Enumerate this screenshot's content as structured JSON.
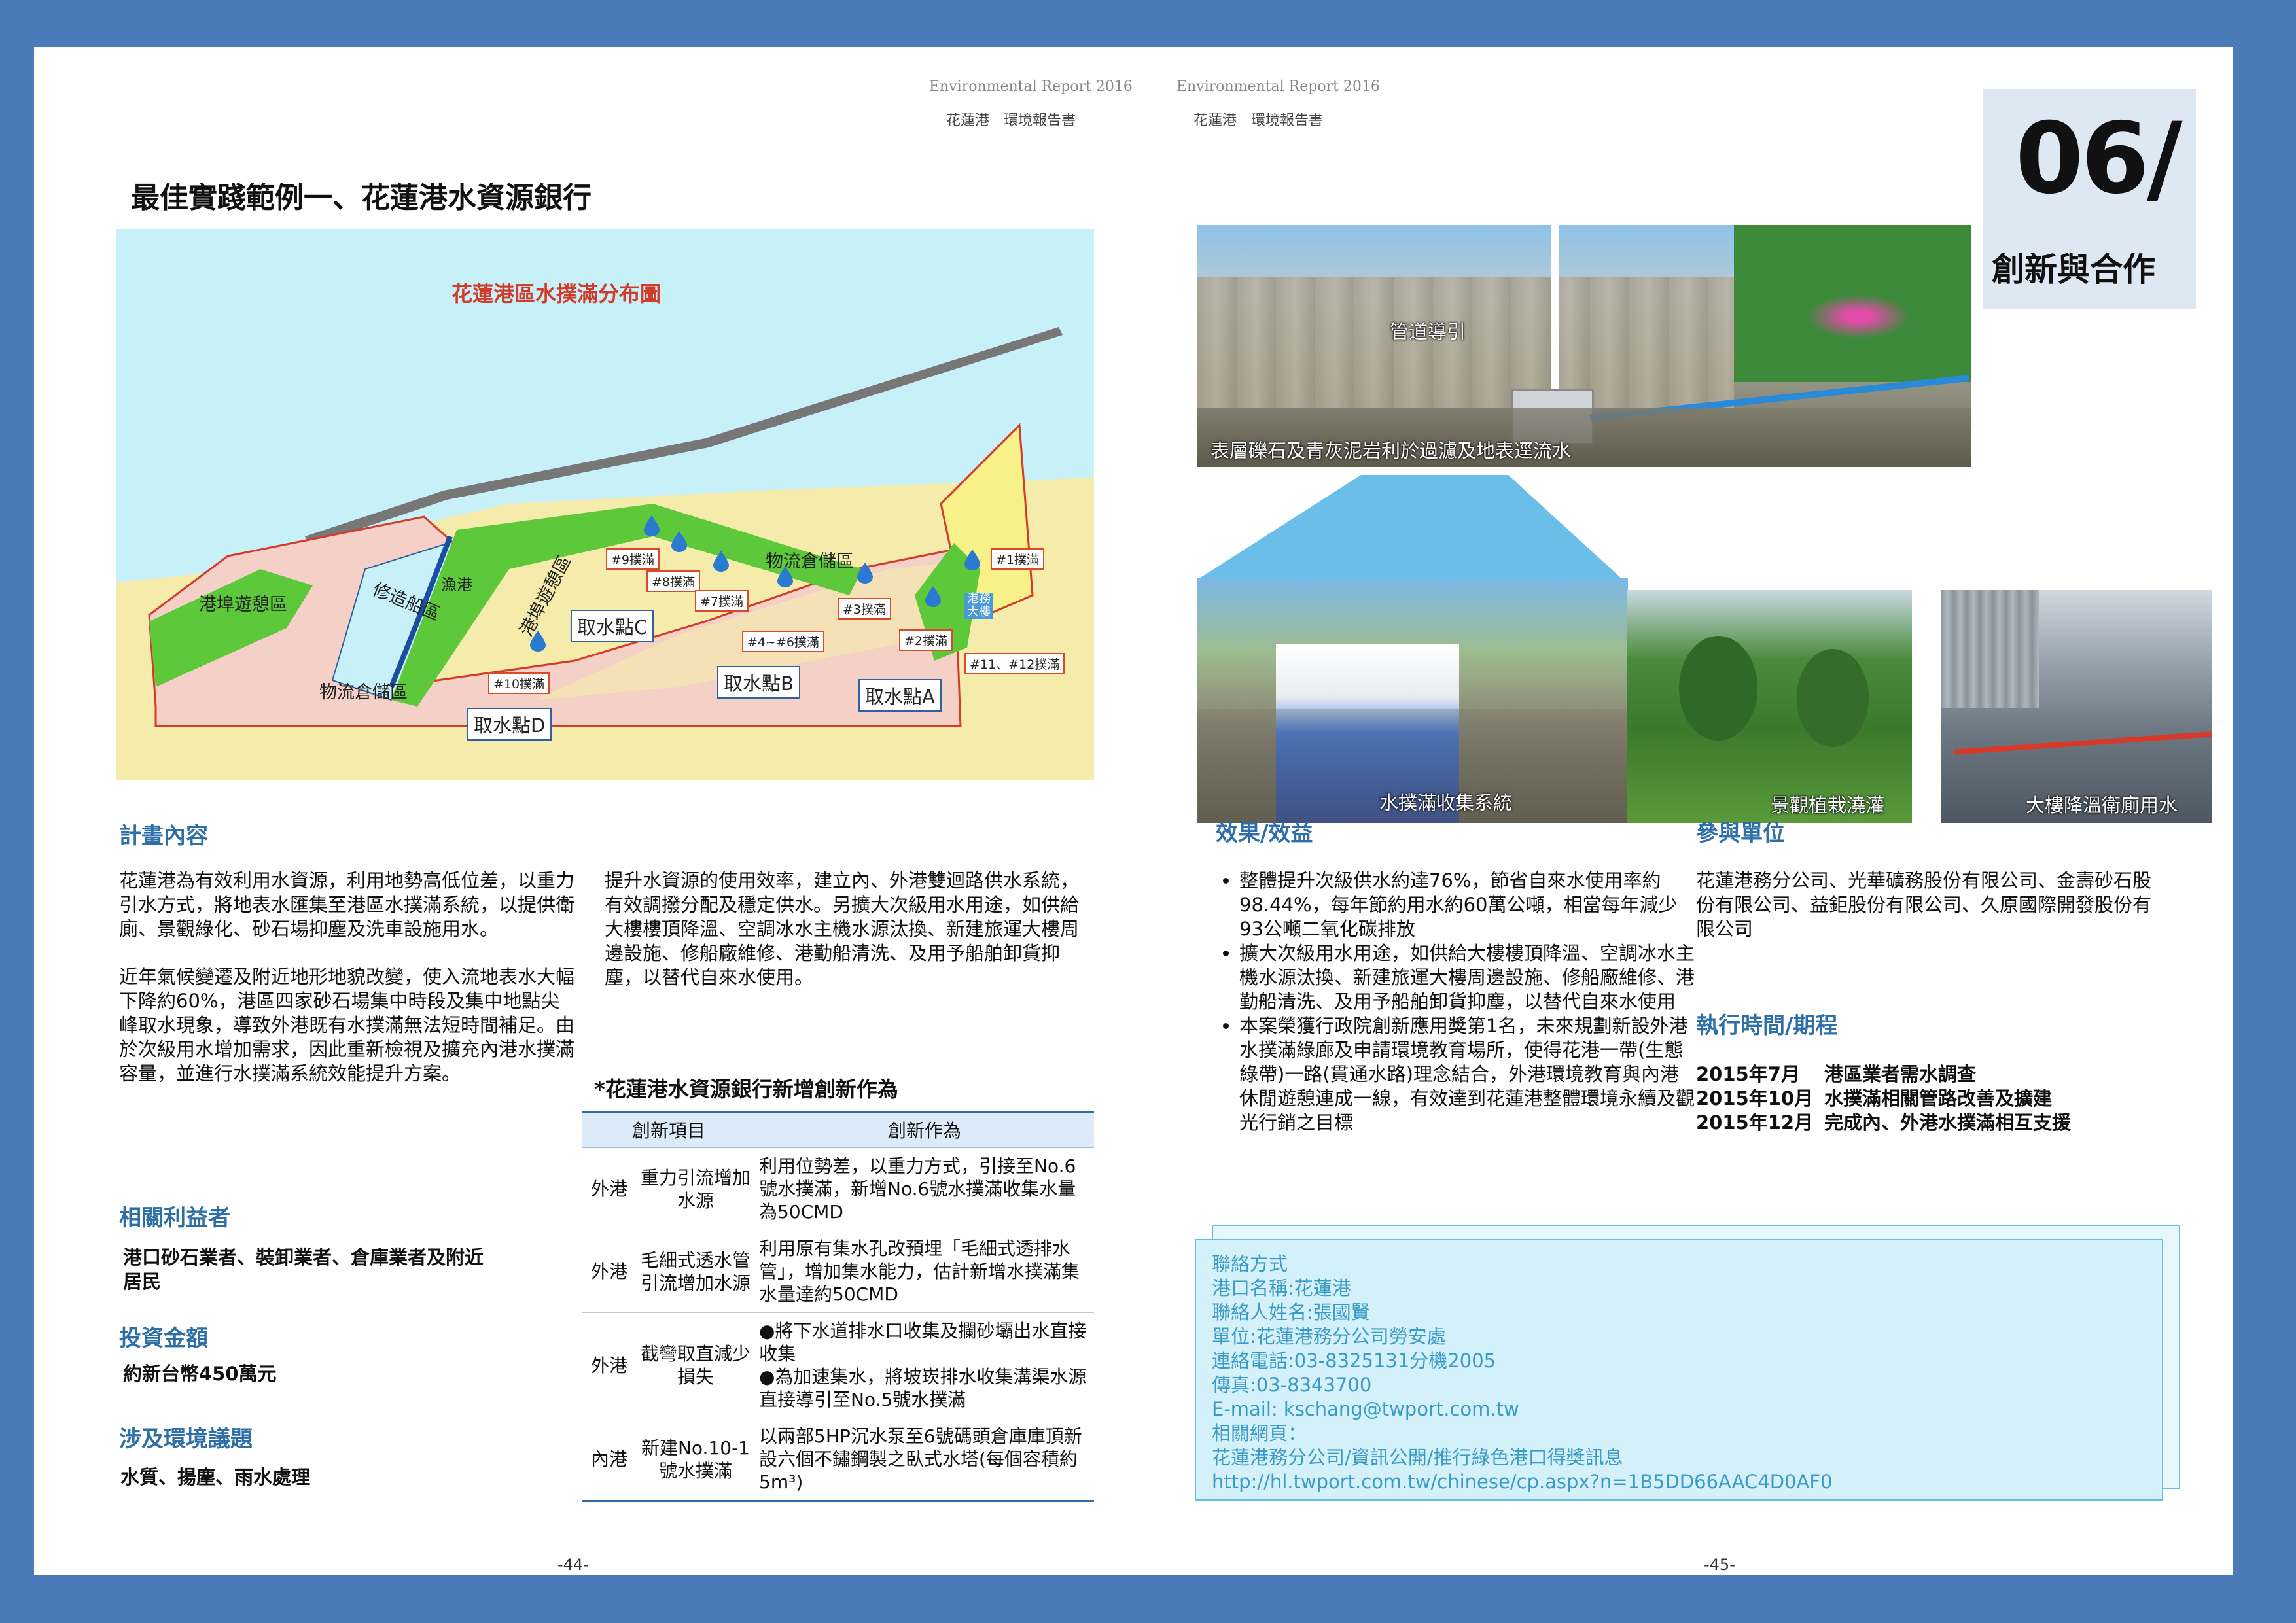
{
  "header": {
    "left_en": "Environmental Report 2016",
    "left_zh": "花蓮港　環境報告書",
    "right_en": "Environmental Report 2016",
    "right_zh": "花蓮港　環境報告書"
  },
  "chapter": {
    "number": "06/",
    "title": "創新與合作"
  },
  "left": {
    "title": "最佳實踐範例一、花蓮港水資源銀行",
    "map": {
      "title": "花蓮港區水撲滿分布圖",
      "zones": [
        "港埠遊憩區",
        "修造船區",
        "漁港",
        "港埠遊憩區",
        "物流倉儲區",
        "物流倉儲區"
      ],
      "tanks": [
        "#9撲滿",
        "#8撲滿",
        "#7撲滿",
        "#4~#6撲滿",
        "#3撲滿",
        "#2撲滿",
        "#1撲滿",
        "#11、#12撲滿",
        "#10撲滿"
      ],
      "points": [
        "取水點C",
        "取水點B",
        "取水點A",
        "取水點D"
      ],
      "small_label": "港務大樓"
    },
    "plan": {
      "heading": "計畫內容",
      "para1": "花蓮港為有效利用水資源，利用地勢高低位差，以重力引水方式，將地表水匯集至港區水撲滿系統，以提供衛廁、景觀綠化、砂石場抑塵及洗車設施用水。",
      "para2": "近年氣候變遷及附近地形地貌改變，使入流地表水大幅下降約60%，港區四家砂石場集中時段及集中地點尖峰取水現象，導致外港既有水撲滿無法短時間補足。由於次級用水增加需求，因此重新檢視及擴充內港水撲滿容量，並進行水撲滿系統效能提升方案。",
      "para3": "提升水資源的使用效率，建立內、外港雙迴路供水系統，有效調撥分配及穩定供水。另擴大次級用水用途，如供給大樓樓頂降溫、空調冰水主機水源汰換、新建旅運大樓周邊設施、修船廠維修、港勤船清洗、及用予船舶卸貨抑塵，以替代自來水使用。"
    },
    "stakeholders": {
      "heading": "相關利益者",
      "text": "港口砂石業者、裝卸業者、倉庫業者及附近居民"
    },
    "investment": {
      "heading": "投資金額",
      "text": "約新台幣450萬元"
    },
    "issues": {
      "heading": "涉及環境議題",
      "text": "水質、揚塵、雨水處理"
    },
    "table": {
      "caption": "*花蓮港水資源銀行新增創新作為",
      "headers": [
        "創新項目",
        "創新作為"
      ],
      "rows": [
        {
          "area": "外港",
          "item": "重力引流增加水源",
          "action": "利用位勢差，以重力方式，引接至No.6號水撲滿，新增No.6號水撲滿收集水量為50CMD"
        },
        {
          "area": "外港",
          "item": "毛細式透水管引流增加水源",
          "action": "利用原有集水孔改預埋「毛細式透排水管」，增加集水能力，估計新增水撲滿集水量達約50CMD"
        },
        {
          "area": "外港",
          "item": "截彎取直減少損失",
          "action1": "●將下水道排水口收集及攔砂壩出水直接收集",
          "action2": "●為加速集水，將坡崁排水收集溝渠水源直接導引至No.5號水撲滿"
        },
        {
          "area": "內港",
          "item": "新建No.10-1號水撲滿",
          "action": "以兩部5HP沉水泵至6號碼頭倉庫庫頂新設六個不鏽鋼製之臥式水塔(每個容積約5m³)"
        }
      ]
    },
    "page_no": "-44-"
  },
  "right": {
    "photos": {
      "p1_cap1": "管道導引",
      "p1_cap2": "表層礫石及青灰泥岩利於過濾及地表逕流水",
      "p2_cap": "水撲滿收集系統",
      "p3_cap": "景觀植栽澆灌",
      "p4_cap": "大樓降溫衛廁用水"
    },
    "effects": {
      "heading": "效果/效益",
      "items": [
        "整體提升次級供水約達76%，節省自來水使用率約98.44%，每年節約用水約60萬公噸，相當每年減少93公噸二氧化碳排放",
        "擴大次級用水用途，如供給大樓樓頂降溫、空調冰水主機水源汰換、新建旅運大樓周邊設施、修船廠維修、港勤船清洗、及用予船舶卸貨抑塵，以替代自來水使用",
        "本案榮獲行政院創新應用獎第1名，未來規劃新設外港水撲滿綠廊及申請環境教育場所，使得花港一帶(生態綠帶)一路(貫通水路)理念結合，外港環境教育與內港休閒遊憩連成一線，有效達到花蓮港整體環境永續及觀光行銷之目標"
      ]
    },
    "participants": {
      "heading": "參與單位",
      "text": "花蓮港務分公司、光華礦務股份有限公司、金壽砂石股份有限公司、益鉅股份有限公司、久原國際開發股份有限公司"
    },
    "schedule": {
      "heading": "執行時間/期程",
      "items": [
        {
          "date": "2015年7月",
          "desc": "港區業者需水調查"
        },
        {
          "date": "2015年10月",
          "desc": "水撲滿相關管路改善及擴建"
        },
        {
          "date": "2015年12月",
          "desc": "完成內、外港水撲滿相互支援"
        }
      ]
    },
    "contact": {
      "lines": [
        "聯絡方式",
        "港口名稱:花蓮港",
        "聯絡人姓名:張國賢",
        "單位:花蓮港務分公司勞安處",
        "連絡電話:03-8325131分機2005",
        "傳真:03-8343700",
        "E-mail: kschang@twport.com.tw",
        "相關網頁：",
        "花蓮港務分公司/資訊公開/推行綠色港口得獎訊息",
        "http://hl.twport.com.tw/chinese/cp.aspx?n=1B5DD66AAC4D0AF0"
      ]
    },
    "page_no": "-45-"
  }
}
